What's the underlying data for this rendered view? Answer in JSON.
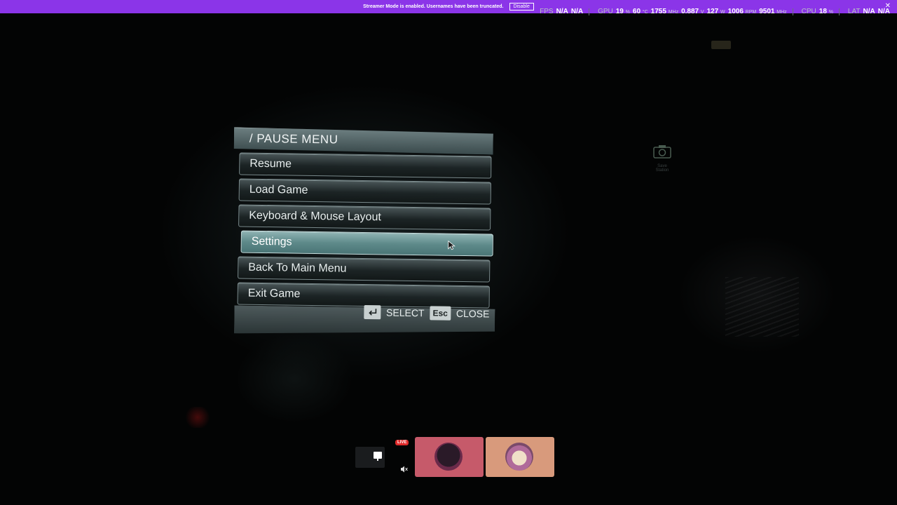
{
  "streamer_bar": {
    "message": "Streamer Mode is enabled. Usernames have been truncated.",
    "disable_label": "Disable",
    "close_glyph": "✕"
  },
  "perf": {
    "fps_label": "FPS",
    "fps_val1": "N/A",
    "fps_val2": "N/A",
    "gpu_label": "GPU",
    "gpu_load": "19",
    "gpu_load_unit": "%",
    "gpu_temp": "60",
    "gpu_temp_unit": "°C",
    "gpu_clock": "1755",
    "gpu_clock_unit": "MHz",
    "gpu_volt": "0.887",
    "gpu_volt_unit": "V",
    "gpu_power": "127",
    "gpu_power_unit": "W",
    "gpu_fan": "1006",
    "gpu_fan_unit": "RPM",
    "gpu_mem": "9501",
    "gpu_mem_unit": "MHz",
    "cpu_label": "CPU",
    "cpu_load": "18",
    "cpu_load_unit": "%",
    "lat_label": "LAT",
    "lat_val1": "N/A",
    "lat_val2": "N/A"
  },
  "scene": {
    "camera_label": "Save Station"
  },
  "pause_menu": {
    "title": "/ PAUSE MENU",
    "items": [
      {
        "label": "Resume"
      },
      {
        "label": "Load Game"
      },
      {
        "label": "Keyboard & Mouse Layout"
      },
      {
        "label": "Settings"
      },
      {
        "label": "Back To Main Menu"
      },
      {
        "label": "Exit Game"
      }
    ],
    "selected_index": 3,
    "footer": {
      "select_label": "SELECT",
      "esc_key": "Esc",
      "close_label": "CLOSE"
    }
  },
  "stream_tiles": {
    "live_label": "LIVE"
  },
  "colors": {
    "streamer_bar": "#8b35e8",
    "menu_selected": "#5e8a8a",
    "live": "#e02b2b"
  },
  "icons": [
    "enter-key-icon",
    "mouse-cursor-icon",
    "monitor-icon",
    "mute-icon",
    "camera-icon"
  ]
}
